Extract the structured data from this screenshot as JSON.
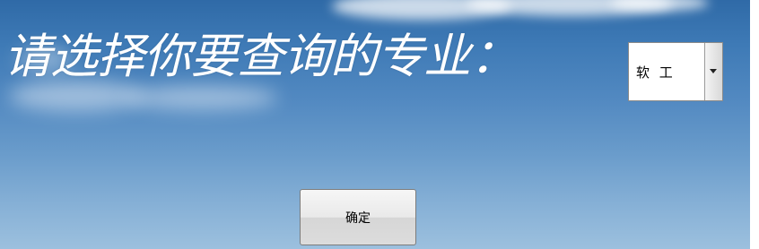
{
  "prompt": {
    "text": "请选择你要查询的专业："
  },
  "major_select": {
    "selected_value": "软 工",
    "dropdown_icon": "chevron-down-icon"
  },
  "confirm_button": {
    "label": "确定"
  },
  "colors": {
    "sky_top": "#2f6aa7",
    "sky_bottom": "#9cc0de",
    "prompt_text": "#ffffff",
    "button_face": "#e9e9e9"
  }
}
